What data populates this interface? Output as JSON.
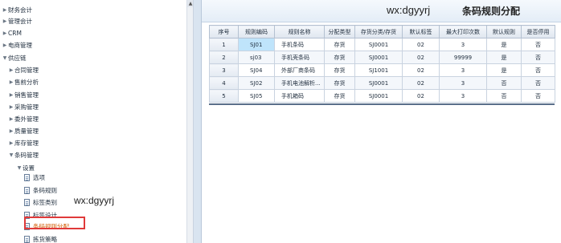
{
  "tree": {
    "items": [
      {
        "label": "财务会计",
        "level": 0,
        "expanded": false
      },
      {
        "label": "管理会计",
        "level": 0,
        "expanded": false
      },
      {
        "label": "CRM",
        "level": 0,
        "expanded": false
      },
      {
        "label": "电商管理",
        "level": 0,
        "expanded": false
      },
      {
        "label": "供应链",
        "level": 0,
        "expanded": true
      },
      {
        "label": "合同管理",
        "level": 1,
        "expanded": false
      },
      {
        "label": "售前分析",
        "level": 1,
        "expanded": false
      },
      {
        "label": "销售管理",
        "level": 1,
        "expanded": false
      },
      {
        "label": "采购管理",
        "level": 1,
        "expanded": false
      },
      {
        "label": "委外管理",
        "level": 1,
        "expanded": false
      },
      {
        "label": "质量管理",
        "level": 1,
        "expanded": false
      },
      {
        "label": "库存管理",
        "level": 1,
        "expanded": false
      },
      {
        "label": "条码管理",
        "level": 1,
        "expanded": true
      },
      {
        "label": "设置",
        "level": 2,
        "expanded": true
      },
      {
        "label": "选项",
        "level": 3,
        "leaf": true
      },
      {
        "label": "条码规则",
        "level": 3,
        "leaf": true
      },
      {
        "label": "标签类别",
        "level": 3,
        "leaf": true
      },
      {
        "label": "标签设计",
        "level": 3,
        "leaf": true
      },
      {
        "label": "条码规则分配",
        "level": 3,
        "leaf": true,
        "selected": true
      },
      {
        "label": "拣货策略",
        "level": 3,
        "leaf": true
      }
    ]
  },
  "watermark": "wx:dgyyrj",
  "page": {
    "title": "条码规则分配"
  },
  "grid": {
    "columns": [
      "序号",
      "规则编码",
      "规则名称",
      "分配类型",
      "存货分类/存货",
      "默认标签",
      "最大打印次数",
      "默认规则",
      "是否停用"
    ],
    "rows": [
      [
        "1",
        "SJ01",
        "手机条码",
        "存货",
        "SJ0001",
        "02",
        "3",
        "是",
        "否"
      ],
      [
        "2",
        "sj03",
        "手机壳条码",
        "存货",
        "SJ0001",
        "02",
        "99999",
        "是",
        "否"
      ],
      [
        "3",
        "SJ04",
        "外部厂商条码",
        "存货",
        "SJ1001",
        "02",
        "3",
        "是",
        "否"
      ],
      [
        "4",
        "SJ02",
        "手机电池解析...",
        "存货",
        "SJ0001",
        "02",
        "3",
        "否",
        "否"
      ],
      [
        "5",
        "SJ05",
        "手机箱码",
        "存货",
        "SJ0001",
        "02",
        "3",
        "否",
        "否"
      ]
    ],
    "selected_cell": {
      "row": 0,
      "col": 1
    }
  },
  "colors": {
    "highlight_border": "#e03a3a",
    "selected_cell": "#bfe4fb",
    "header_bg": "#e4edf7"
  }
}
